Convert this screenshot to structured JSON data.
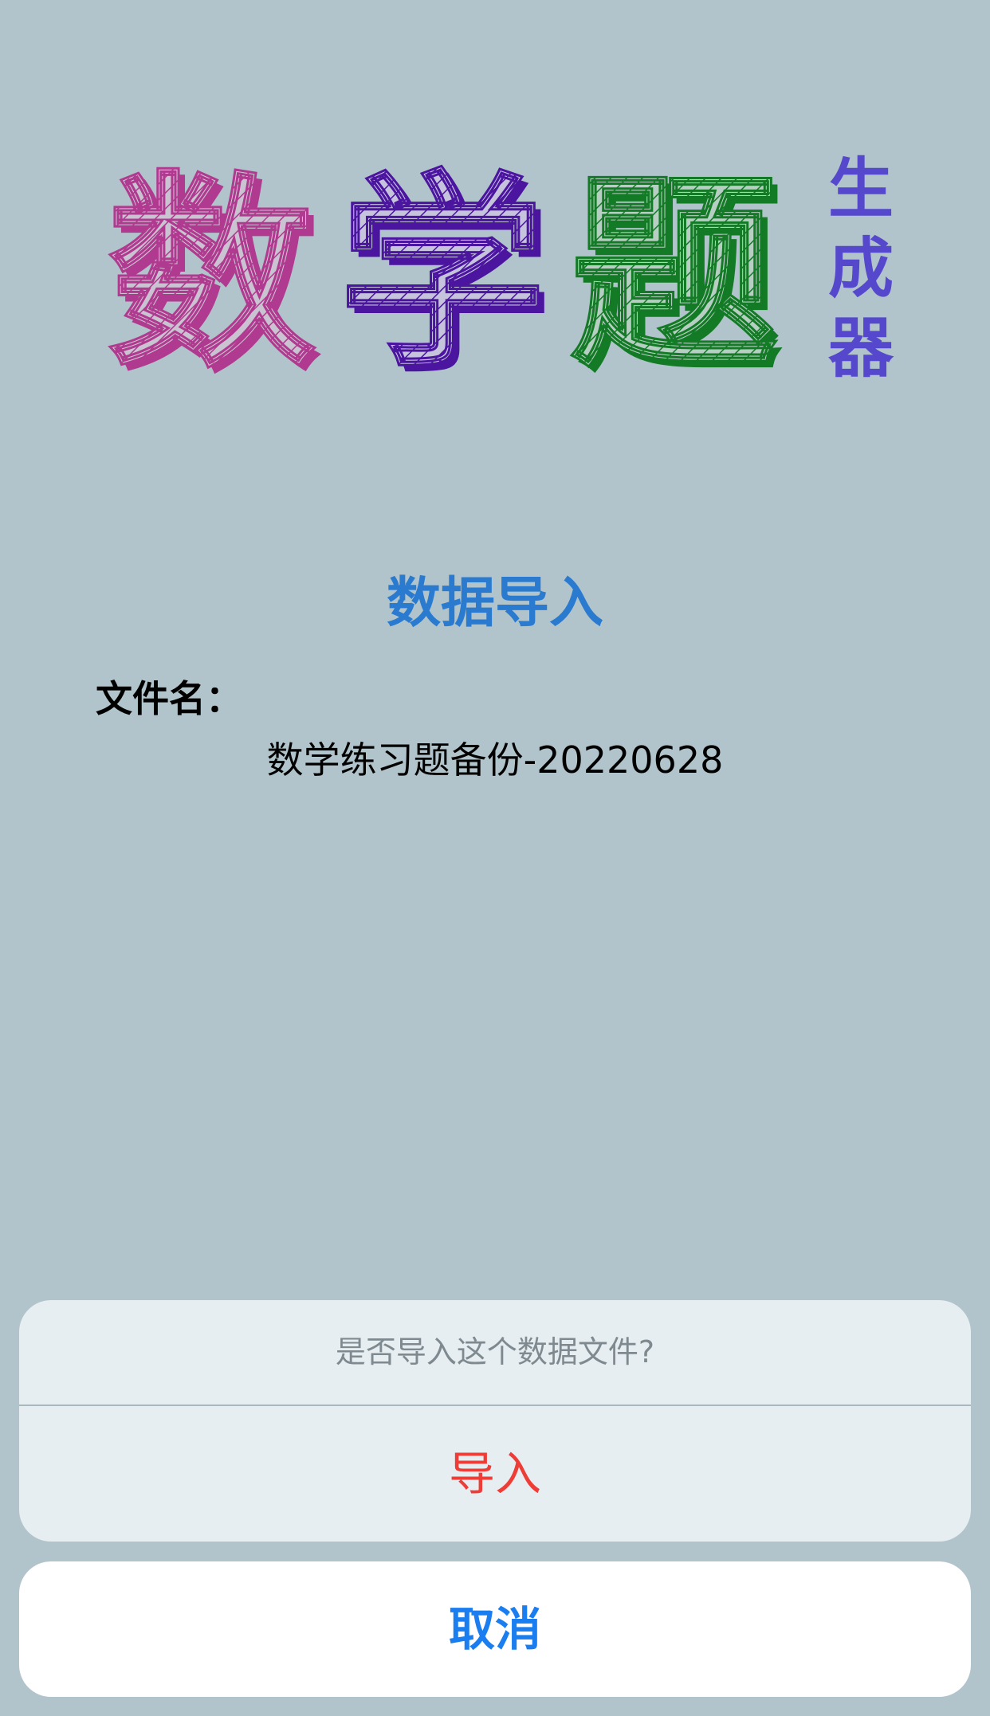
{
  "logo": {
    "chars": [
      {
        "text": "数",
        "color": "#b03a8f"
      },
      {
        "text": "学",
        "color": "#4b15a0"
      },
      {
        "text": "题",
        "color": "#137a25"
      }
    ],
    "sub": [
      "生",
      "成",
      "器"
    ],
    "sub_color": "#5548cc"
  },
  "page": {
    "title": "数据导入",
    "file_label": "文件名：",
    "file_name": "数学练习题备份-20220628"
  },
  "action_sheet": {
    "message": "是否导入这个数据文件?",
    "import_label": "导入",
    "cancel_label": "取消"
  },
  "colors": {
    "background": "#b1c4cb",
    "title": "#2a7bd0",
    "destructive": "#ee3c36",
    "cancel": "#1a7ef0"
  }
}
